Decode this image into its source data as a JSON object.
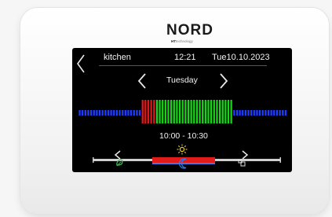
{
  "brand": {
    "name": "NORD",
    "sub_strong": "HT",
    "sub_rest": "technology"
  },
  "header": {
    "room": "kitchen",
    "time": "12:21",
    "date": "Tue10.10.2023"
  },
  "day_selector": {
    "label": "Tuesday"
  },
  "schedule": {
    "period_colors": [
      "blue",
      "blue",
      "blue",
      "blue",
      "blue",
      "blue",
      "blue",
      "blue",
      "blue",
      "blue",
      "blue",
      "blue",
      "blue",
      "blue",
      "blue",
      "blue",
      "blue",
      "blue",
      "blue",
      "blue",
      "blue",
      "blue",
      "red",
      "red",
      "red",
      "red",
      "red",
      "green",
      "green",
      "green",
      "green",
      "green",
      "green",
      "green",
      "green",
      "green",
      "green",
      "green",
      "green",
      "green",
      "green",
      "green",
      "green",
      "green",
      "green",
      "green",
      "green",
      "green",
      "green",
      "green",
      "green",
      "green",
      "green",
      "green",
      "blue",
      "blue",
      "blue",
      "blue",
      "blue",
      "blue",
      "blue",
      "blue",
      "blue",
      "blue",
      "blue",
      "blue",
      "blue",
      "blue",
      "blue",
      "blue",
      "blue",
      "blue",
      "blue"
    ],
    "selected_range": "10:00 - 10:30"
  },
  "modes": {
    "items": [
      {
        "name": "eco",
        "icon": "eco-icon",
        "color": "#33c24a"
      },
      {
        "name": "comfort",
        "icon": "sun-icon",
        "color": "#f2d21b"
      },
      {
        "name": "night",
        "icon": "moon-icon",
        "color": "#2f7ff0"
      },
      {
        "name": "antifreeze",
        "icon": "antifreeze-icon",
        "color": "#dddddd"
      }
    ],
    "selected": "comfort"
  },
  "colors": {
    "blue": "#1f3dff",
    "red": "#e01818",
    "green": "#14d814",
    "screen": "#000000"
  }
}
